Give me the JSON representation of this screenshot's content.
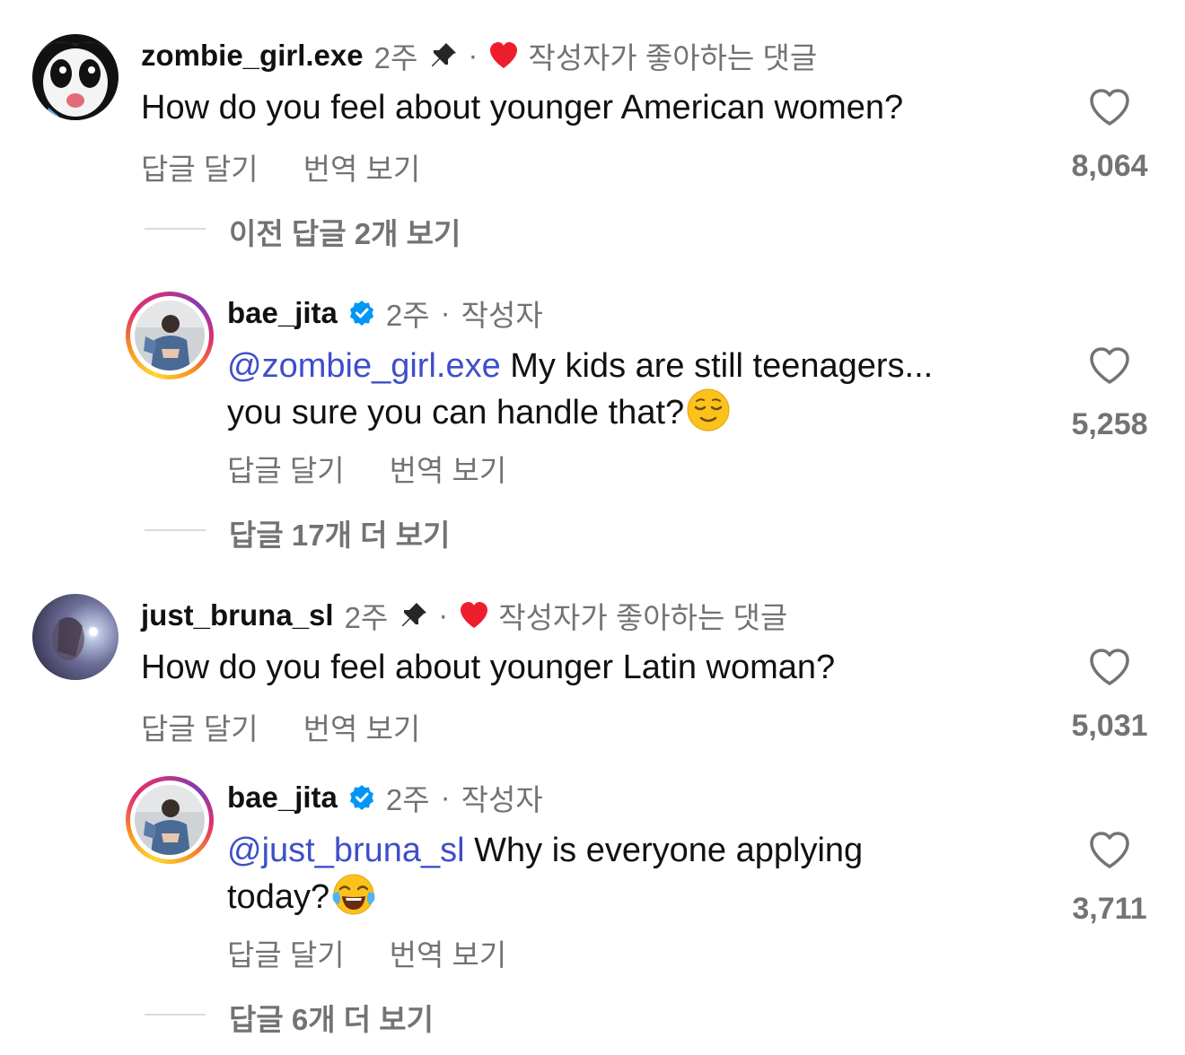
{
  "comments": [
    {
      "username": "zombie_girl.exe",
      "time": "2주",
      "separator": "·",
      "author_liked": "작성자가 좋아하는 댓글",
      "text": "How do you feel about younger American women?",
      "actions": {
        "reply": "답글 달기",
        "translate": "번역 보기"
      },
      "likes": "8,064",
      "thread_link": "이전 답글 2개 보기",
      "reply": {
        "username": "bae_jita",
        "time": "2주",
        "separator": "·",
        "role": "작성자",
        "mention": "@zombie_girl.exe",
        "text_line1": " My kids are still teenagers...",
        "text_line2": "you sure you can handle that?",
        "emoji": "relieved-face",
        "actions": {
          "reply": "답글 달기",
          "translate": "번역 보기"
        },
        "likes": "5,258",
        "more_link": "답글 17개 더 보기"
      }
    },
    {
      "username": "just_bruna_sl",
      "time": "2주",
      "separator": "·",
      "author_liked": "작성자가 좋아하는 댓글",
      "text": "How do you feel about younger Latin woman?",
      "actions": {
        "reply": "답글 달기",
        "translate": "번역 보기"
      },
      "likes": "5,031",
      "reply": {
        "username": "bae_jita",
        "time": "2주",
        "separator": "·",
        "role": "작성자",
        "mention": "@just_bruna_sl",
        "text_line1": " Why is everyone applying",
        "text_line2": "today?",
        "emoji": "face-with-tears-of-joy",
        "actions": {
          "reply": "답글 달기",
          "translate": "번역 보기"
        },
        "likes": "3,711",
        "more_link": "답글 6개 더 보기"
      }
    }
  ],
  "colors": {
    "mention": "#3e4fc9",
    "muted": "#737373",
    "red_heart": "#ee1d2e",
    "verified": "#0095f6",
    "divider": "#dbdbdb"
  }
}
